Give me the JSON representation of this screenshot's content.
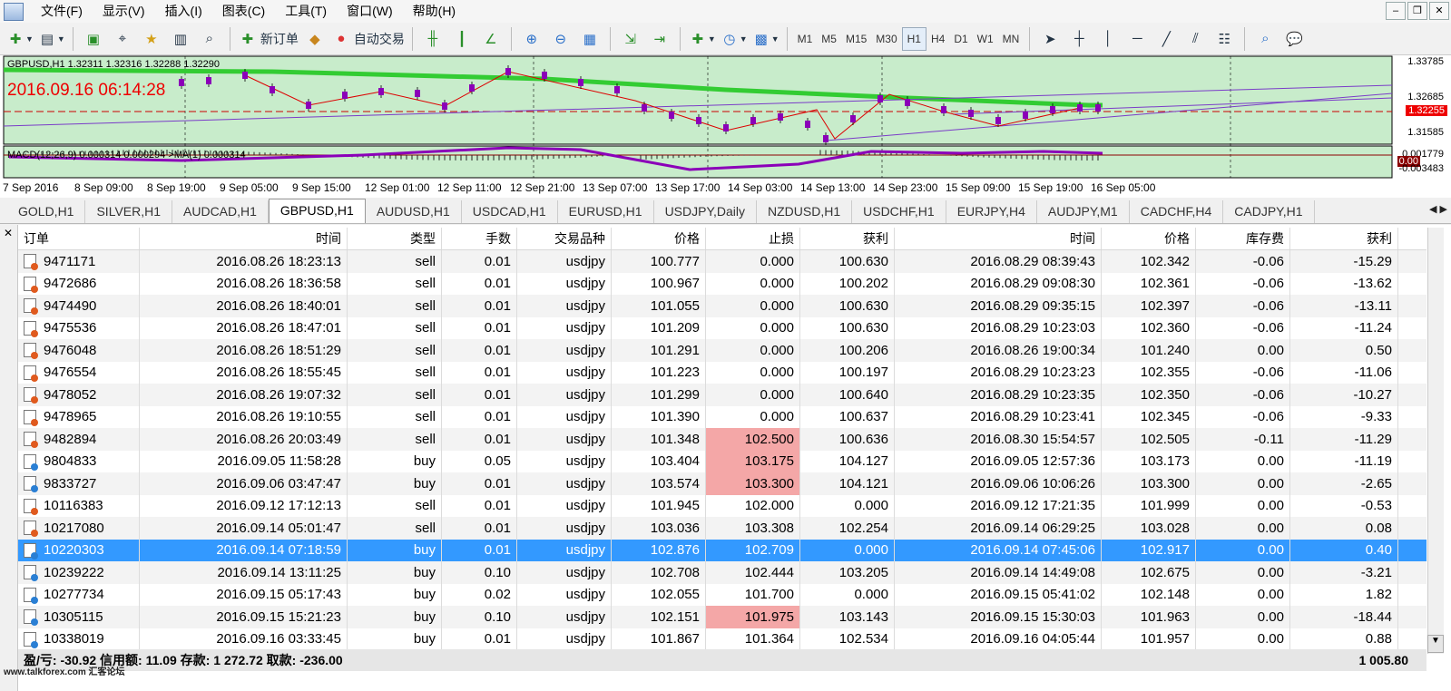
{
  "menu": [
    "文件(F)",
    "显示(V)",
    "插入(I)",
    "图表(C)",
    "工具(T)",
    "窗口(W)",
    "帮助(H)"
  ],
  "toolbar": {
    "new_order": "新订单",
    "auto_trading": "自动交易",
    "timeframes": [
      "M1",
      "M5",
      "M15",
      "M30",
      "H1",
      "H4",
      "D1",
      "W1",
      "MN"
    ],
    "active_timeframe": "H1"
  },
  "chart": {
    "title": "GBPUSD,H1  1.32311 1.32316 1.32288 1.32290",
    "time_label": "2016.09.16 06:14:28",
    "macd_label": "MACD(12,26,9) 0.000314 0.000294  >MA(1) 0.000314",
    "price_ticks": [
      "1.33785",
      "1.32685",
      "1.31585"
    ],
    "current_price": "1.32255",
    "macd_ticks": [
      "0.001779",
      "0.00",
      "-0.003483"
    ],
    "time_ticks": [
      "7 Sep 2016",
      "8 Sep 09:00",
      "8 Sep 19:00",
      "9 Sep 05:00",
      "9 Sep 15:00",
      "12 Sep 01:00",
      "12 Sep 11:00",
      "12 Sep 21:00",
      "13 Sep 07:00",
      "13 Sep 17:00",
      "14 Sep 03:00",
      "14 Sep 13:00",
      "14 Sep 23:00",
      "15 Sep 09:00",
      "15 Sep 19:00",
      "16 Sep 05:00"
    ]
  },
  "tabs": [
    "GOLD,H1",
    "SILVER,H1",
    "AUDCAD,H1",
    "GBPUSD,H1",
    "AUDUSD,H1",
    "USDCAD,H1",
    "EURUSD,H1",
    "USDJPY,Daily",
    "NZDUSD,H1",
    "USDCHF,H1",
    "EURJPY,H4",
    "AUDJPY,M1",
    "CADCHF,H4",
    "CADJPY,H1"
  ],
  "active_tab": "GBPUSD,H1",
  "table": {
    "headers": [
      "订单",
      "时间",
      "类型",
      "手数",
      "交易品种",
      "价格",
      "止损",
      "获利",
      "时间",
      "价格",
      "库存费",
      "获利"
    ],
    "rows": [
      [
        "9471171",
        "2016.08.26 18:23:13",
        "sell",
        "0.01",
        "usdjpy",
        "100.777",
        "0.000",
        "100.630",
        "2016.08.29 08:39:43",
        "102.342",
        "-0.06",
        "-15.29"
      ],
      [
        "9472686",
        "2016.08.26 18:36:58",
        "sell",
        "0.01",
        "usdjpy",
        "100.967",
        "0.000",
        "100.202",
        "2016.08.29 09:08:30",
        "102.361",
        "-0.06",
        "-13.62"
      ],
      [
        "9474490",
        "2016.08.26 18:40:01",
        "sell",
        "0.01",
        "usdjpy",
        "101.055",
        "0.000",
        "100.630",
        "2016.08.29 09:35:15",
        "102.397",
        "-0.06",
        "-13.11"
      ],
      [
        "9475536",
        "2016.08.26 18:47:01",
        "sell",
        "0.01",
        "usdjpy",
        "101.209",
        "0.000",
        "100.630",
        "2016.08.29 10:23:03",
        "102.360",
        "-0.06",
        "-11.24"
      ],
      [
        "9476048",
        "2016.08.26 18:51:29",
        "sell",
        "0.01",
        "usdjpy",
        "101.291",
        "0.000",
        "100.206",
        "2016.08.26 19:00:34",
        "101.240",
        "0.00",
        "0.50"
      ],
      [
        "9476554",
        "2016.08.26 18:55:45",
        "sell",
        "0.01",
        "usdjpy",
        "101.223",
        "0.000",
        "100.197",
        "2016.08.29 10:23:23",
        "102.355",
        "-0.06",
        "-11.06"
      ],
      [
        "9478052",
        "2016.08.26 19:07:32",
        "sell",
        "0.01",
        "usdjpy",
        "101.299",
        "0.000",
        "100.640",
        "2016.08.29 10:23:35",
        "102.350",
        "-0.06",
        "-10.27"
      ],
      [
        "9478965",
        "2016.08.26 19:10:55",
        "sell",
        "0.01",
        "usdjpy",
        "101.390",
        "0.000",
        "100.637",
        "2016.08.29 10:23:41",
        "102.345",
        "-0.06",
        "-9.33"
      ],
      [
        "9482894",
        "2016.08.26 20:03:49",
        "sell",
        "0.01",
        "usdjpy",
        "101.348",
        "102.500",
        "100.636",
        "2016.08.30 15:54:57",
        "102.505",
        "-0.11",
        "-11.29"
      ],
      [
        "9804833",
        "2016.09.05 11:58:28",
        "buy",
        "0.05",
        "usdjpy",
        "103.404",
        "103.175",
        "104.127",
        "2016.09.05 12:57:36",
        "103.173",
        "0.00",
        "-11.19"
      ],
      [
        "9833727",
        "2016.09.06 03:47:47",
        "buy",
        "0.01",
        "usdjpy",
        "103.574",
        "103.300",
        "104.121",
        "2016.09.06 10:06:26",
        "103.300",
        "0.00",
        "-2.65"
      ],
      [
        "10116383",
        "2016.09.12 17:12:13",
        "sell",
        "0.01",
        "usdjpy",
        "101.945",
        "102.000",
        "0.000",
        "2016.09.12 17:21:35",
        "101.999",
        "0.00",
        "-0.53"
      ],
      [
        "10217080",
        "2016.09.14 05:01:47",
        "sell",
        "0.01",
        "usdjpy",
        "103.036",
        "103.308",
        "102.254",
        "2016.09.14 06:29:25",
        "103.028",
        "0.00",
        "0.08"
      ],
      [
        "10220303",
        "2016.09.14 07:18:59",
        "buy",
        "0.01",
        "usdjpy",
        "102.876",
        "102.709",
        "0.000",
        "2016.09.14 07:45:06",
        "102.917",
        "0.00",
        "0.40"
      ],
      [
        "10239222",
        "2016.09.14 13:11:25",
        "buy",
        "0.10",
        "usdjpy",
        "102.708",
        "102.444",
        "103.205",
        "2016.09.14 14:49:08",
        "102.675",
        "0.00",
        "-3.21"
      ],
      [
        "10277734",
        "2016.09.15 05:17:43",
        "buy",
        "0.02",
        "usdjpy",
        "102.055",
        "101.700",
        "0.000",
        "2016.09.15 05:41:02",
        "102.148",
        "0.00",
        "1.82"
      ],
      [
        "10305115",
        "2016.09.15 15:21:23",
        "buy",
        "0.10",
        "usdjpy",
        "102.151",
        "101.975",
        "103.143",
        "2016.09.15 15:30:03",
        "101.963",
        "0.00",
        "-18.44"
      ],
      [
        "10338019",
        "2016.09.16 03:33:45",
        "buy",
        "0.01",
        "usdjpy",
        "101.867",
        "101.364",
        "102.534",
        "2016.09.16 04:05:44",
        "101.957",
        "0.00",
        "0.88"
      ]
    ],
    "highlight_sl_rows": [
      8,
      9,
      10,
      16
    ],
    "selected_row": 13
  },
  "summary": {
    "text": "盈/亏: -30.92  信用额: 11.09  存款: 1 272.72  取款: -236.00",
    "total": "1 005.80"
  },
  "watermark": "www.talkforex.com 汇客论坛",
  "colors": {
    "chart_bg": "#c8eccb",
    "candle": "#8b00b8",
    "ma_line": "#33cc33",
    "selected_row": "#3399ff",
    "sl_highlight": "#f4a7a7"
  }
}
